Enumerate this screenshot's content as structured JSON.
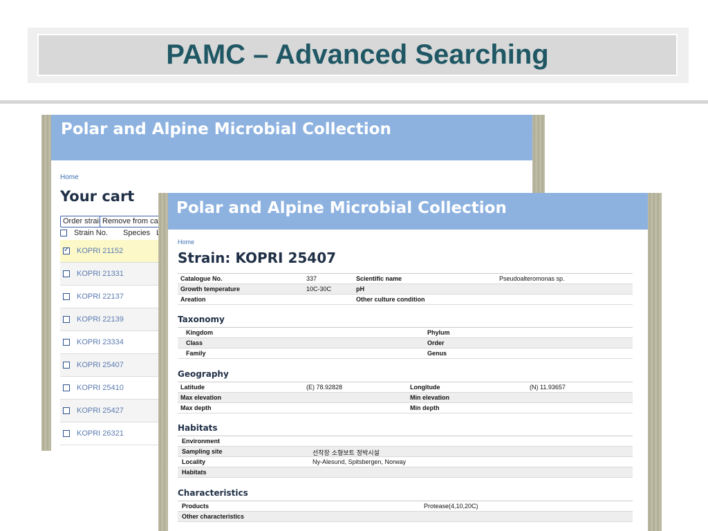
{
  "slide": {
    "title": "PAMC – Advanced Searching"
  },
  "cart_window": {
    "header_title": "Polar and Alpine Microbial Collection",
    "breadcrumb": "Home",
    "heading": "Your cart",
    "order_button": "Order strain",
    "remove_button": "Remove from cart",
    "columns": [
      "Strain No.",
      "Species",
      "L"
    ],
    "rows": [
      {
        "strain": "KOPRI 21152",
        "checked": true
      },
      {
        "strain": "KOPRI 21331",
        "checked": false
      },
      {
        "strain": "KOPRI 22137",
        "checked": false
      },
      {
        "strain": "KOPRI 22139",
        "checked": false
      },
      {
        "strain": "KOPRI 23334",
        "checked": false
      },
      {
        "strain": "KOPRI 25407",
        "checked": false
      },
      {
        "strain": "KOPRI 25410",
        "checked": false
      },
      {
        "strain": "KOPRI 25427",
        "checked": false
      },
      {
        "strain": "KOPRI 26321",
        "checked": false
      }
    ]
  },
  "strain_window": {
    "header_title": "Polar and Alpine Microbial Collection",
    "breadcrumb": "Home",
    "heading": "Strain: KOPRI 25407",
    "summary": {
      "catalogue_label": "Catalogue No.",
      "catalogue_value": "337",
      "sciname_label": "Scientific name",
      "sciname_value": "Pseudoalteromonas sp.",
      "growth_label": "Growth temperature",
      "growth_value": "10C-30C",
      "ph_label": "pH",
      "aeration_label": "Areation",
      "other_culture_label": "Other culture condition"
    },
    "taxonomy": {
      "title": "Taxonomy",
      "kingdom": "Kingdom",
      "phylum": "Phylum",
      "class": "Class",
      "order": "Order",
      "family": "Family",
      "genus": "Genus"
    },
    "geography": {
      "title": "Geography",
      "latitude_label": "Latitude",
      "latitude_value": "(E) 78.92828",
      "longitude_label": "Longitude",
      "longitude_value": "(N) 11.93657",
      "max_elev": "Max elevation",
      "min_elev": "Min elevation",
      "max_depth": "Max depth",
      "min_depth": "Min depth"
    },
    "habitats": {
      "title": "Habitats",
      "environment": "Environment",
      "sampling_label": "Sampling site",
      "sampling_value": "선착장 소형보트 정박시설",
      "locality_label": "Locality",
      "locality_value": "Ny-Alesund, Spitsbergen, Norway",
      "habitats_label": "Habitats"
    },
    "characteristics": {
      "title": "Characteristics",
      "products_label": "Products",
      "products_value": "Protease(4,10,20C)",
      "other_label": "Other characteristics"
    }
  }
}
